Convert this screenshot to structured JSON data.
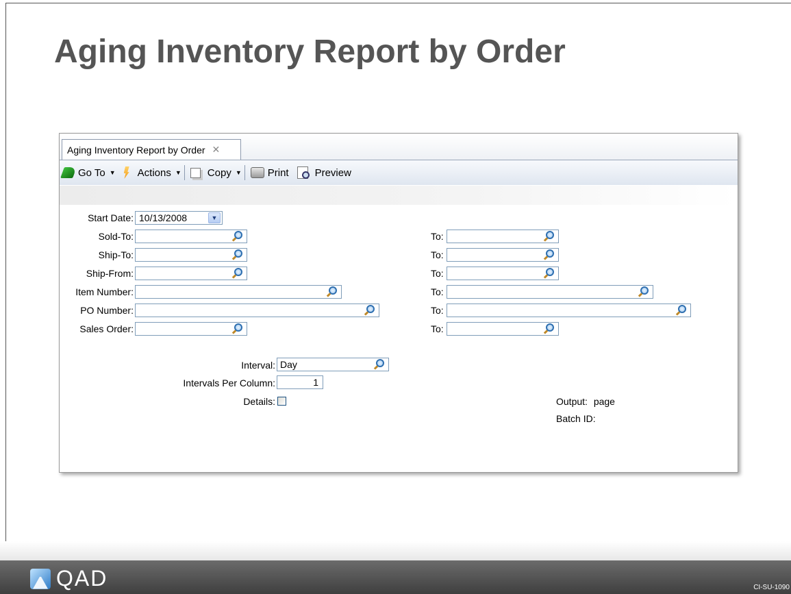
{
  "slide": {
    "title": "Aging Inventory Report by Order",
    "logo_text": "QAD",
    "code": "CI-SU-1090"
  },
  "tab": {
    "label": "Aging Inventory Report by Order",
    "close_glyph": "✕"
  },
  "toolbar": {
    "goto_label": "Go To",
    "actions_label": "Actions",
    "copy_label": "Copy",
    "print_label": "Print",
    "preview_label": "Preview",
    "caret_glyph": "▼"
  },
  "form": {
    "start_date": {
      "label": "Start Date:",
      "value": "10/13/2008",
      "button_glyph": "▼"
    },
    "sold_to": {
      "label": "Sold-To:",
      "value": "",
      "to_label": "To:",
      "to_value": ""
    },
    "ship_to": {
      "label": "Ship-To:",
      "value": "",
      "to_label": "To:",
      "to_value": ""
    },
    "ship_from": {
      "label": "Ship-From:",
      "value": "",
      "to_label": "To:",
      "to_value": ""
    },
    "item_number": {
      "label": "Item Number:",
      "value": "",
      "to_label": "To:",
      "to_value": ""
    },
    "po_number": {
      "label": "PO Number:",
      "value": "",
      "to_label": "To:",
      "to_value": ""
    },
    "sales_order": {
      "label": "Sales Order:",
      "value": "",
      "to_label": "To:",
      "to_value": ""
    },
    "interval": {
      "label": "Interval:",
      "value": "Day"
    },
    "intervals_per_column": {
      "label": "Intervals Per Column:",
      "value": "1"
    },
    "details": {
      "label": "Details:",
      "checked": false
    },
    "output": {
      "label": "Output:",
      "value": "page"
    },
    "batch_id": {
      "label": "Batch ID:",
      "value": ""
    }
  }
}
